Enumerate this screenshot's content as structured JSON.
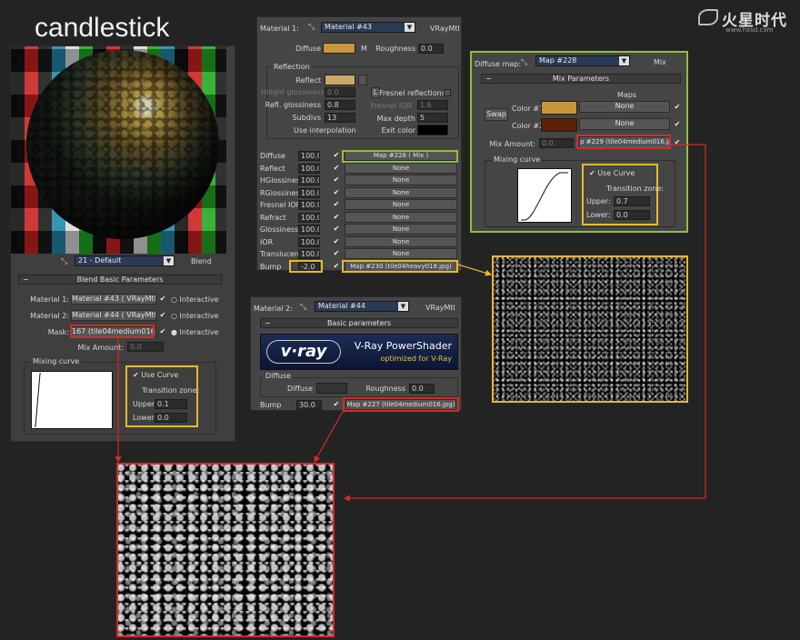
{
  "title": "candlestick",
  "logo": {
    "text": "火星时代",
    "url": "www.hxsd.com"
  },
  "blend": {
    "material_dropdown": "21 - Default",
    "type": "Blend",
    "rollout": "Blend Basic Parameters",
    "mat1_label": "Material 1:",
    "mat1_value": "Material #43  ( VRayMtl )",
    "mat2_label": "Material 2:",
    "mat2_value": "Material #44  ( VRayMtl )",
    "mask_label": "Mask:",
    "mask_value": "167 (tile04medium016.jpg)",
    "interactive": "Interactive",
    "mix_amount_label": "Mix Amount:",
    "mix_amount": "0.0",
    "mixing_curve": "Mixing curve",
    "use_curve": "Use Curve",
    "transition_zone": "Transition zone:",
    "upper_label": "Upper:",
    "upper": "0.1",
    "lower_label": "Lower:",
    "lower": "0.0"
  },
  "material1": {
    "label": "Material 1:",
    "name": "Material #43",
    "type": "VRayMtl",
    "diffuse_label": "Diffuse",
    "m": "M",
    "roughness_label": "Roughness",
    "roughness": "0.0",
    "reflection": "Reflection",
    "reflect": "Reflect",
    "hilight_label": "Hilight glossiness",
    "hilight": "0.0",
    "l": "L",
    "fresnel_label": "Fresnel reflections",
    "refl_gloss_label": "Refl. glossiness",
    "refl_gloss": "0.8",
    "fresnel_ior_label": "Fresnel IOR",
    "fresnel_ior": "1.6",
    "subdivs_label": "Subdivs",
    "subdivs": "13",
    "max_depth_label": "Max depth",
    "max_depth": "5",
    "use_interp": "Use interpolation",
    "exit_color": "Exit color"
  },
  "maps": [
    {
      "name": "Diffuse",
      "amount": "100.0",
      "map": "Map #228  ( Mix )"
    },
    {
      "name": "Reflect",
      "amount": "100.0",
      "map": "None"
    },
    {
      "name": "HGlossiness",
      "amount": "100.0",
      "map": "None"
    },
    {
      "name": "RGlossiness",
      "amount": "100.0",
      "map": "None"
    },
    {
      "name": "Fresnel IOR",
      "amount": "100.0",
      "map": "None"
    },
    {
      "name": "Refract",
      "amount": "100.0",
      "map": "None"
    },
    {
      "name": "Glossiness",
      "amount": "100.0",
      "map": "None"
    },
    {
      "name": "IOR",
      "amount": "100.0",
      "map": "None"
    },
    {
      "name": "Translucent",
      "amount": "100.0",
      "map": "None"
    },
    {
      "name": "Bump",
      "amount": "-2.0",
      "map": "Map #230 (tile04heavy018.jpg)"
    }
  ],
  "mix": {
    "label": "Diffuse map:",
    "name": "Map #228",
    "type": "Mix",
    "rollout": "Mix Parameters",
    "maps_header": "Maps",
    "swap": "Swap",
    "color1_label": "Color #1",
    "color1_map": "None",
    "color2_label": "Color #2",
    "color2_map": "None",
    "mix_amount_label": "Mix Amount:",
    "mix_amount": "0.0",
    "mix_map": "p #229 (tile04medium016.jpg)",
    "mixing_curve": "Mixing curve",
    "use_curve": "Use Curve",
    "transition_zone": "Transition zone:",
    "upper_label": "Upper:",
    "upper": "0.7",
    "lower_label": "Lower:",
    "lower": "0.0"
  },
  "material2": {
    "label": "Material 2:",
    "name": "Material #44",
    "type": "VRayMtl",
    "rollout": "Basic parameters",
    "banner_title": "V-Ray PowerShader",
    "banner_sub": "optimized for V-Ray",
    "vray_logo": "v·ray",
    "diffuse_group": "Diffuse",
    "diffuse_label": "Diffuse",
    "roughness_label": "Roughness",
    "roughness": "0.0",
    "bump_label": "Bump",
    "bump": "30.0",
    "bump_map": "Map #227 (tile04medium016.jpg)"
  },
  "colors": {
    "highlight_yellow": "#e6b92e",
    "highlight_red": "#d42a2a",
    "highlight_green": "#8fbf3a",
    "swatch_tan": "#c9953a",
    "swatch_brown": "#5e1f07"
  }
}
